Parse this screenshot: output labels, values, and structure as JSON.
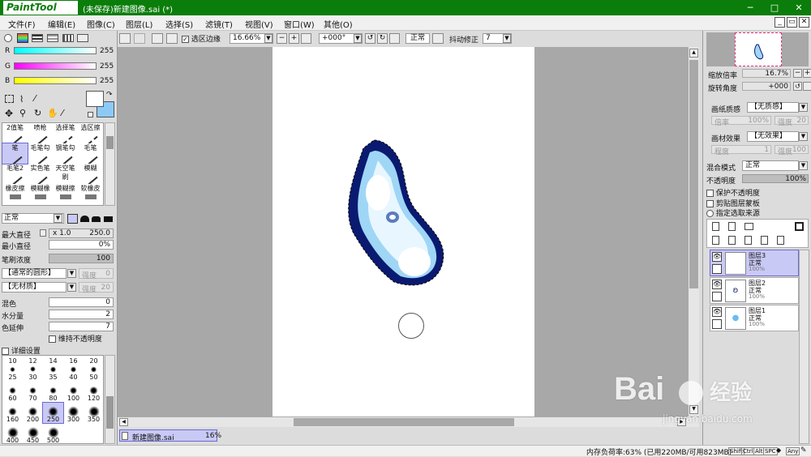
{
  "titlebar": {
    "logo": "PaintTool SAI",
    "title": "(未保存)新建图像.sai (*)",
    "min": "─",
    "max": "□",
    "close": "✕"
  },
  "menu": [
    "文件(F)",
    "编辑(E)",
    "图像(C)",
    "图层(L)",
    "选择(S)",
    "滤镜(T)",
    "视图(V)",
    "窗口(W)",
    "其他(O)"
  ],
  "mdi": {
    "min": "_",
    "restore": "▭",
    "close": "✕"
  },
  "color": {
    "r_label": "R",
    "g_label": "G",
    "b_label": "B",
    "r_val": "255",
    "g_val": "255",
    "b_val": "255"
  },
  "tools": [
    [
      "2值笔",
      "喷枪",
      "选择笔",
      "选区擦"
    ],
    [
      "笔",
      "毛笔勾",
      "钢笔勾",
      "毛笔"
    ],
    [
      "毛笔2",
      "实色笔",
      "天空笔刷",
      "模糊"
    ],
    [
      "橡皮擦",
      "模糊橡",
      "模糊擦",
      "软橡皮"
    ]
  ],
  "brush": {
    "mode": "正常",
    "max_diameter_label": "最大直径",
    "max_diameter_mult": "x 1.0",
    "max_diameter_val": "250.0",
    "min_diameter_label": "最小直径",
    "min_diameter_val": "0%",
    "density_label": "笔刷浓度",
    "density_val": "100",
    "shape": "【通常的圆形】",
    "shape_strength_label": "强度",
    "shape_strength": "0",
    "texture": "【无材质】",
    "texture_strength_label": "强度",
    "texture_strength": "20",
    "blend_label": "混色",
    "blend_val": "0",
    "water_label": "水分量",
    "water_val": "2",
    "persist_label": "色延伸",
    "persist_val": "7",
    "keep_opacity": "维持不透明度",
    "detail": "详细设置"
  },
  "sizes": [
    "10",
    "12",
    "14",
    "16",
    "20",
    "25",
    "30",
    "35",
    "40",
    "50",
    "60",
    "70",
    "80",
    "100",
    "120",
    "160",
    "200",
    "250",
    "300",
    "350",
    "400",
    "450",
    "500"
  ],
  "toolbar": {
    "sel_edge": "选区边缘",
    "zoom": "16.66%",
    "rotate": "+000°",
    "mode": "正常",
    "stab_label": "抖动修正",
    "stab_val": "7"
  },
  "tab": {
    "name": "新建图像.sai",
    "zoom": "16%"
  },
  "navigator": {
    "zoom_label": "缩放倍率",
    "zoom_val": "16.7%",
    "rotate_label": "旋转角度",
    "rotate_val": "+000"
  },
  "paper": {
    "texture_label": "画纸质感",
    "texture_val": "【无质感】",
    "tex_mult_label": "倍率",
    "tex_mult": "100%",
    "tex_strength_label": "强度",
    "tex_strength": "20",
    "effect_label": "画材效果",
    "effect_val": "【无效果】",
    "eff_width_label": "程度",
    "eff_width": "1",
    "eff_strength_label": "强度",
    "eff_strength": "100"
  },
  "layerprops": {
    "blend_label": "混合模式",
    "blend_val": "正常",
    "opacity_label": "不透明度",
    "opacity_val": "100%",
    "protect": "保护不透明度",
    "clip": "剪贴图层蒙板",
    "source": "指定选取来源"
  },
  "layers": [
    {
      "name": "图层3",
      "mode": "正常",
      "opacity": "100%"
    },
    {
      "name": "图层2",
      "mode": "正常",
      "opacity": "100%"
    },
    {
      "name": "图层1",
      "mode": "正常",
      "opacity": "100%"
    }
  ],
  "status": {
    "memory": "内存负荷率:63% (已用220MB/可用823MB)",
    "keys": [
      "Shift",
      "Ctrl",
      "Alt",
      "SPC",
      "◆",
      "Any"
    ]
  },
  "watermark": {
    "brand": "Bai",
    "brand2": "经验",
    "url": "jingyan.baidu.com"
  }
}
